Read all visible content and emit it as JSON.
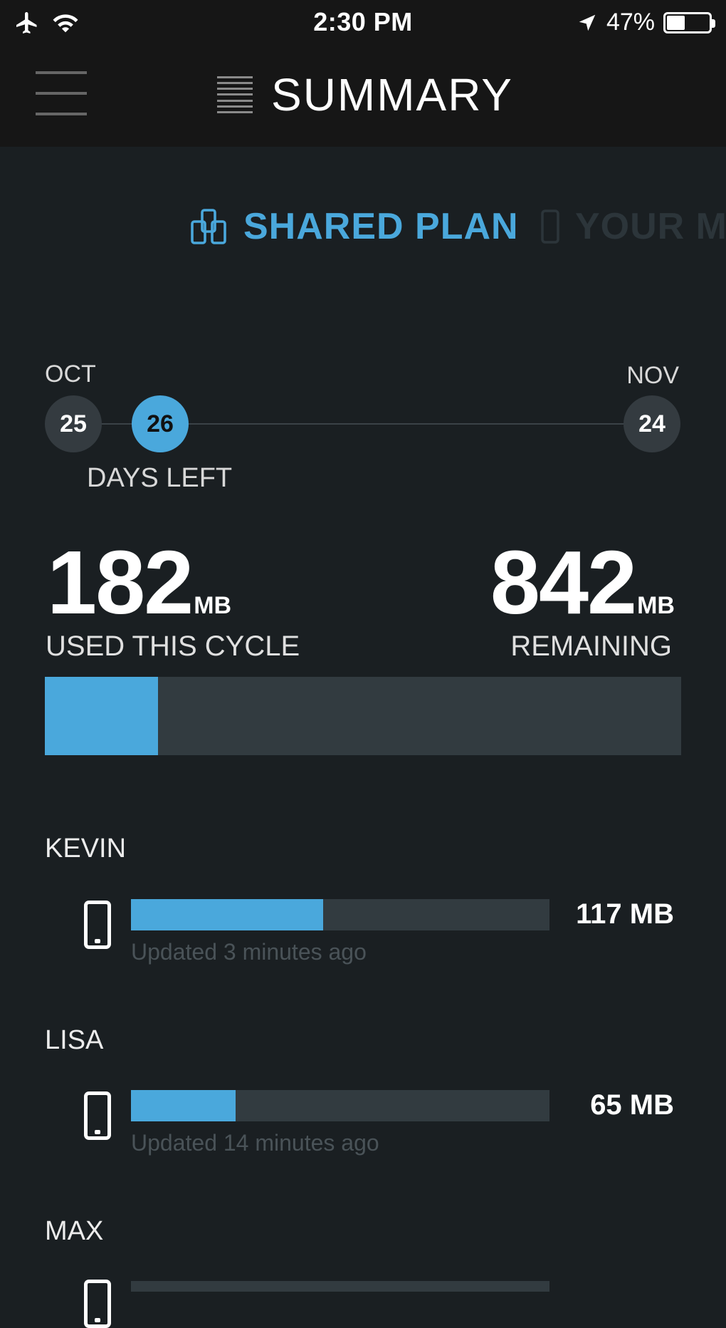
{
  "status_bar": {
    "time": "2:30 PM",
    "battery_percent": "47%",
    "battery_level": 0.47
  },
  "nav": {
    "title": "SUMMARY"
  },
  "tabs": [
    {
      "label": "SHARED PLAN",
      "active": true
    },
    {
      "label": "YOUR M",
      "active": false
    }
  ],
  "cycle": {
    "start_month": "OCT",
    "start_day": "25",
    "days_left": "26",
    "days_left_label": "DAYS LEFT",
    "end_month": "NOV",
    "end_day": "24"
  },
  "usage": {
    "used": "182",
    "used_unit": "MB",
    "used_label": "USED THIS CYCLE",
    "remaining": "842",
    "remaining_unit": "MB",
    "remaining_label": "REMAINING",
    "used_fraction": 0.178
  },
  "users": [
    {
      "name": "KEVIN",
      "amount": "117 MB",
      "updated": "Updated 3 minutes ago",
      "fraction": 0.46
    },
    {
      "name": "LISA",
      "amount": "65 MB",
      "updated": "Updated 14 minutes ago",
      "fraction": 0.25
    },
    {
      "name": "MAX"
    }
  ],
  "colors": {
    "accent": "#4aa8dc",
    "background": "#1a1f22",
    "bar_track": "#323b40",
    "header": "#161616"
  }
}
